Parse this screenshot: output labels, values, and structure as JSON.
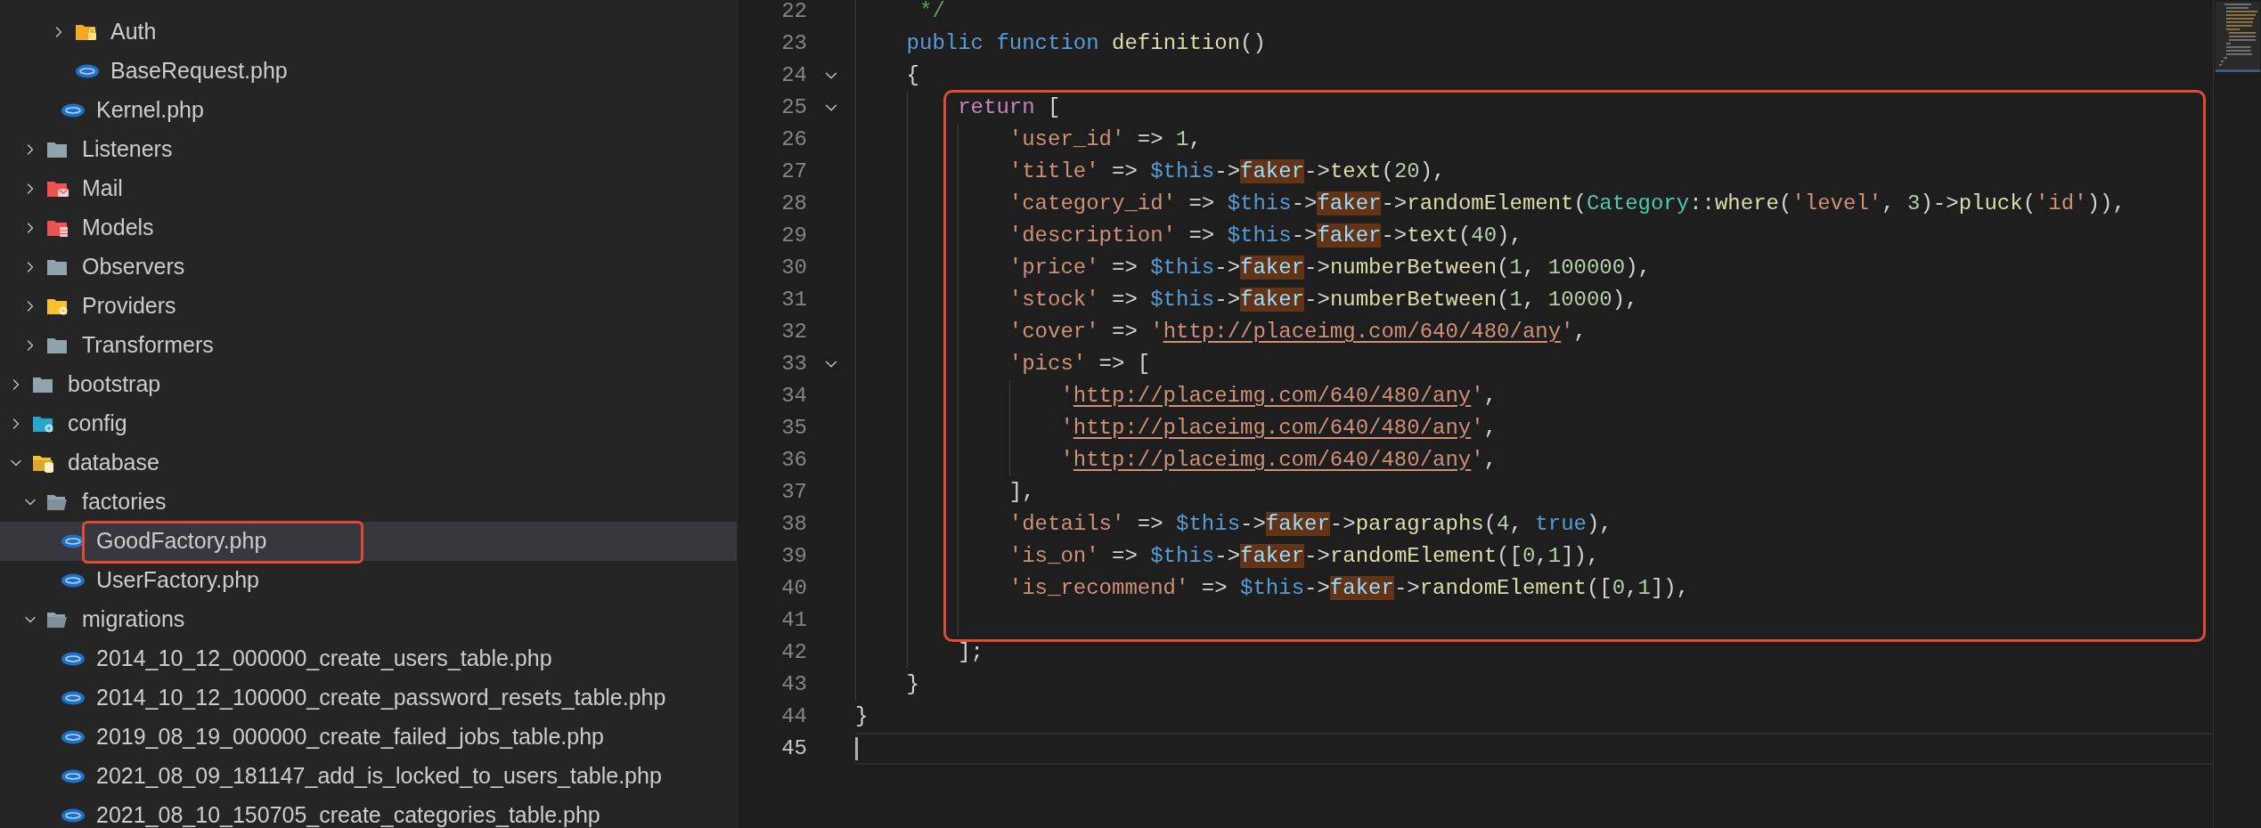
{
  "explorer": {
    "items": [
      {
        "children": [
          {
            "children": [
              {
                "children": [
                  {
                    "label": "Auth",
                    "kind": "lock-folder",
                    "expanded": false,
                    "selected": false,
                    "framed": false
                  },
                  {
                    "label": "BaseRequest.php",
                    "kind": "php-file",
                    "selected": false,
                    "framed": false
                  }
                ]
              },
              {
                "label": "Kernel.php",
                "kind": "php-file",
                "selected": false,
                "framed": false
              }
            ]
          },
          {
            "label": "Listeners",
            "kind": "folder",
            "expanded": false,
            "selected": false,
            "framed": false
          },
          {
            "label": "Mail",
            "kind": "mail-folder",
            "expanded": false,
            "selected": false,
            "framed": false
          },
          {
            "label": "Models",
            "kind": "models-folder",
            "expanded": false,
            "selected": false,
            "framed": false
          },
          {
            "label": "Observers",
            "kind": "folder",
            "expanded": false,
            "selected": false,
            "framed": false
          },
          {
            "label": "Providers",
            "kind": "gear-folder",
            "expanded": false,
            "selected": false,
            "framed": false
          },
          {
            "label": "Transformers",
            "kind": "folder",
            "expanded": false,
            "selected": false,
            "framed": false
          }
        ]
      },
      {
        "label": "bootstrap",
        "kind": "folder",
        "expanded": false,
        "selected": false,
        "framed": false
      },
      {
        "label": "config",
        "kind": "config-folder",
        "expanded": false,
        "selected": false,
        "framed": false
      },
      {
        "label": "database",
        "kind": "database-folder",
        "expanded": true,
        "selected": false,
        "framed": false,
        "children": [
          {
            "label": "factories",
            "kind": "folder",
            "expanded": true,
            "selected": false,
            "framed": false,
            "children": [
              {
                "label": "GoodFactory.php",
                "kind": "php-file",
                "selected": true,
                "framed": true
              },
              {
                "label": "UserFactory.php",
                "kind": "php-file",
                "selected": false,
                "framed": false
              }
            ]
          },
          {
            "label": "migrations",
            "kind": "folder",
            "expanded": true,
            "selected": false,
            "framed": false,
            "children": [
              {
                "label": "2014_10_12_000000_create_users_table.php",
                "kind": "php-file",
                "selected": false,
                "framed": false
              },
              {
                "label": "2014_10_12_100000_create_password_resets_table.php",
                "kind": "php-file",
                "selected": false,
                "framed": false
              },
              {
                "label": "2019_08_19_000000_create_failed_jobs_table.php",
                "kind": "php-file",
                "selected": false,
                "framed": false
              },
              {
                "label": "2021_08_09_181147_add_is_locked_to_users_table.php",
                "kind": "php-file",
                "selected": false,
                "framed": false
              },
              {
                "label": "2021_08_10_150705_create_categories_table.php",
                "kind": "php-file",
                "selected": false,
                "framed": false
              }
            ]
          }
        ]
      }
    ]
  },
  "editor": {
    "lines": [
      {
        "children": [
          {
            "number": "22",
            "fold": false,
            "current": false,
            "framed": false,
            "tokens": [
              {
                "kind": "comment",
                "text": " */"
              }
            ]
          },
          {
            "number": "23",
            "fold": false,
            "current": false,
            "framed": false,
            "tokens": [
              {
                "kind": "keyword",
                "text": "public function "
              },
              {
                "kind": "function",
                "text": "definition"
              },
              {
                "kind": "plain",
                "text": "()"
              }
            ]
          },
          {
            "number": "24",
            "fold": true,
            "current": false,
            "framed": false,
            "tokens": [
              {
                "kind": "plain",
                "text": "{"
              }
            ],
            "children": [
              {
                "number": "25",
                "fold": true,
                "current": false,
                "framed": true,
                "tokens": [
                  {
                    "kind": "control",
                    "text": "return"
                  },
                  {
                    "kind": "plain",
                    "text": " ["
                  }
                ],
                "children": [
                  {
                    "number": "26",
                    "fold": false,
                    "current": false,
                    "framed": false,
                    "tokens": [
                      {
                        "kind": "string",
                        "text": "'user_id'"
                      },
                      {
                        "kind": "plain",
                        "text": " => "
                      },
                      {
                        "kind": "number",
                        "text": "1"
                      },
                      {
                        "kind": "plain",
                        "text": ","
                      }
                    ]
                  },
                  {
                    "number": "27",
                    "fold": false,
                    "current": false,
                    "framed": false,
                    "tokens": [
                      {
                        "kind": "string",
                        "text": "'title'"
                      },
                      {
                        "kind": "plain",
                        "text": " => "
                      },
                      {
                        "kind": "variable",
                        "text": "$this"
                      },
                      {
                        "kind": "plain",
                        "text": "->"
                      },
                      {
                        "kind": "match",
                        "text": "faker"
                      },
                      {
                        "kind": "plain",
                        "text": "->"
                      },
                      {
                        "kind": "function",
                        "text": "text"
                      },
                      {
                        "kind": "plain",
                        "text": "("
                      },
                      {
                        "kind": "number",
                        "text": "20"
                      },
                      {
                        "kind": "plain",
                        "text": "),"
                      }
                    ]
                  },
                  {
                    "number": "28",
                    "fold": false,
                    "current": false,
                    "framed": false,
                    "tokens": [
                      {
                        "kind": "string",
                        "text": "'category_id'"
                      },
                      {
                        "kind": "plain",
                        "text": " => "
                      },
                      {
                        "kind": "variable",
                        "text": "$this"
                      },
                      {
                        "kind": "plain",
                        "text": "->"
                      },
                      {
                        "kind": "match",
                        "text": "faker"
                      },
                      {
                        "kind": "plain",
                        "text": "->"
                      },
                      {
                        "kind": "function",
                        "text": "randomElement"
                      },
                      {
                        "kind": "plain",
                        "text": "("
                      },
                      {
                        "kind": "class",
                        "text": "Category"
                      },
                      {
                        "kind": "plain",
                        "text": "::"
                      },
                      {
                        "kind": "function",
                        "text": "where"
                      },
                      {
                        "kind": "plain",
                        "text": "("
                      },
                      {
                        "kind": "string",
                        "text": "'level'"
                      },
                      {
                        "kind": "plain",
                        "text": ", "
                      },
                      {
                        "kind": "number",
                        "text": "3"
                      },
                      {
                        "kind": "plain",
                        "text": ")->"
                      },
                      {
                        "kind": "function",
                        "text": "pluck"
                      },
                      {
                        "kind": "plain",
                        "text": "("
                      },
                      {
                        "kind": "string",
                        "text": "'id'"
                      },
                      {
                        "kind": "plain",
                        "text": ")),"
                      }
                    ]
                  },
                  {
                    "number": "29",
                    "fold": false,
                    "current": false,
                    "framed": false,
                    "tokens": [
                      {
                        "kind": "string",
                        "text": "'description'"
                      },
                      {
                        "kind": "plain",
                        "text": " => "
                      },
                      {
                        "kind": "variable",
                        "text": "$this"
                      },
                      {
                        "kind": "plain",
                        "text": "->"
                      },
                      {
                        "kind": "match",
                        "text": "faker"
                      },
                      {
                        "kind": "plain",
                        "text": "->"
                      },
                      {
                        "kind": "function",
                        "text": "text"
                      },
                      {
                        "kind": "plain",
                        "text": "("
                      },
                      {
                        "kind": "number",
                        "text": "40"
                      },
                      {
                        "kind": "plain",
                        "text": "),"
                      }
                    ]
                  },
                  {
                    "number": "30",
                    "fold": false,
                    "current": false,
                    "framed": false,
                    "tokens": [
                      {
                        "kind": "string",
                        "text": "'price'"
                      },
                      {
                        "kind": "plain",
                        "text": " => "
                      },
                      {
                        "kind": "variable",
                        "text": "$this"
                      },
                      {
                        "kind": "plain",
                        "text": "->"
                      },
                      {
                        "kind": "match",
                        "text": "faker"
                      },
                      {
                        "kind": "plain",
                        "text": "->"
                      },
                      {
                        "kind": "function",
                        "text": "numberBetween"
                      },
                      {
                        "kind": "plain",
                        "text": "("
                      },
                      {
                        "kind": "number",
                        "text": "1"
                      },
                      {
                        "kind": "plain",
                        "text": ", "
                      },
                      {
                        "kind": "number",
                        "text": "100000"
                      },
                      {
                        "kind": "plain",
                        "text": "),"
                      }
                    ]
                  },
                  {
                    "number": "31",
                    "fold": false,
                    "current": false,
                    "framed": false,
                    "tokens": [
                      {
                        "kind": "string",
                        "text": "'stock'"
                      },
                      {
                        "kind": "plain",
                        "text": " => "
                      },
                      {
                        "kind": "variable",
                        "text": "$this"
                      },
                      {
                        "kind": "plain",
                        "text": "->"
                      },
                      {
                        "kind": "match",
                        "text": "faker"
                      },
                      {
                        "kind": "plain",
                        "text": "->"
                      },
                      {
                        "kind": "function",
                        "text": "numberBetween"
                      },
                      {
                        "kind": "plain",
                        "text": "("
                      },
                      {
                        "kind": "number",
                        "text": "1"
                      },
                      {
                        "kind": "plain",
                        "text": ", "
                      },
                      {
                        "kind": "number",
                        "text": "10000"
                      },
                      {
                        "kind": "plain",
                        "text": "),"
                      }
                    ]
                  },
                  {
                    "number": "32",
                    "fold": false,
                    "current": false,
                    "framed": false,
                    "tokens": [
                      {
                        "kind": "string",
                        "text": "'cover'"
                      },
                      {
                        "kind": "plain",
                        "text": " => "
                      },
                      {
                        "kind": "string",
                        "text": "'"
                      },
                      {
                        "kind": "link",
                        "text": "http://placeimg.com/640/480/any"
                      },
                      {
                        "kind": "string",
                        "text": "'"
                      },
                      {
                        "kind": "plain",
                        "text": ","
                      }
                    ]
                  },
                  {
                    "number": "33",
                    "fold": true,
                    "current": false,
                    "framed": false,
                    "tokens": [
                      {
                        "kind": "string",
                        "text": "'pics'"
                      },
                      {
                        "kind": "plain",
                        "text": " => ["
                      }
                    ],
                    "children": [
                      {
                        "number": "34",
                        "fold": false,
                        "current": false,
                        "framed": false,
                        "tokens": [
                          {
                            "kind": "string",
                            "text": "'"
                          },
                          {
                            "kind": "link",
                            "text": "http://placeimg.com/640/480/any"
                          },
                          {
                            "kind": "string",
                            "text": "'"
                          },
                          {
                            "kind": "plain",
                            "text": ","
                          }
                        ]
                      },
                      {
                        "number": "35",
                        "fold": false,
                        "current": false,
                        "framed": false,
                        "tokens": [
                          {
                            "kind": "string",
                            "text": "'"
                          },
                          {
                            "kind": "link",
                            "text": "http://placeimg.com/640/480/any"
                          },
                          {
                            "kind": "string",
                            "text": "'"
                          },
                          {
                            "kind": "plain",
                            "text": ","
                          }
                        ]
                      },
                      {
                        "number": "36",
                        "fold": false,
                        "current": false,
                        "framed": false,
                        "tokens": [
                          {
                            "kind": "string",
                            "text": "'"
                          },
                          {
                            "kind": "link",
                            "text": "http://placeimg.com/640/480/any"
                          },
                          {
                            "kind": "string",
                            "text": "'"
                          },
                          {
                            "kind": "plain",
                            "text": ","
                          }
                        ]
                      }
                    ]
                  },
                  {
                    "number": "37",
                    "fold": false,
                    "current": false,
                    "framed": false,
                    "tokens": [
                      {
                        "kind": "plain",
                        "text": "],"
                      }
                    ]
                  },
                  {
                    "number": "38",
                    "fold": false,
                    "current": false,
                    "framed": false,
                    "tokens": [
                      {
                        "kind": "string",
                        "text": "'details'"
                      },
                      {
                        "kind": "plain",
                        "text": " => "
                      },
                      {
                        "kind": "variable",
                        "text": "$this"
                      },
                      {
                        "kind": "plain",
                        "text": "->"
                      },
                      {
                        "kind": "match",
                        "text": "faker"
                      },
                      {
                        "kind": "plain",
                        "text": "->"
                      },
                      {
                        "kind": "function",
                        "text": "paragraphs"
                      },
                      {
                        "kind": "plain",
                        "text": "("
                      },
                      {
                        "kind": "number",
                        "text": "4"
                      },
                      {
                        "kind": "plain",
                        "text": ", "
                      },
                      {
                        "kind": "keyword",
                        "text": "true"
                      },
                      {
                        "kind": "plain",
                        "text": "),"
                      }
                    ]
                  },
                  {
                    "number": "39",
                    "fold": false,
                    "current": false,
                    "framed": false,
                    "tokens": [
                      {
                        "kind": "string",
                        "text": "'is_on'"
                      },
                      {
                        "kind": "plain",
                        "text": " => "
                      },
                      {
                        "kind": "variable",
                        "text": "$this"
                      },
                      {
                        "kind": "plain",
                        "text": "->"
                      },
                      {
                        "kind": "match",
                        "text": "faker"
                      },
                      {
                        "kind": "plain",
                        "text": "->"
                      },
                      {
                        "kind": "function",
                        "text": "randomElement"
                      },
                      {
                        "kind": "plain",
                        "text": "(["
                      },
                      {
                        "kind": "number",
                        "text": "0"
                      },
                      {
                        "kind": "plain",
                        "text": ","
                      },
                      {
                        "kind": "number",
                        "text": "1"
                      },
                      {
                        "kind": "plain",
                        "text": "]),"
                      }
                    ]
                  },
                  {
                    "number": "40",
                    "fold": false,
                    "current": false,
                    "framed": false,
                    "tokens": [
                      {
                        "kind": "string",
                        "text": "'is_recommend'"
                      },
                      {
                        "kind": "plain",
                        "text": " => "
                      },
                      {
                        "kind": "variable",
                        "text": "$this"
                      },
                      {
                        "kind": "plain",
                        "text": "->"
                      },
                      {
                        "kind": "match",
                        "text": "faker"
                      },
                      {
                        "kind": "plain",
                        "text": "->"
                      },
                      {
                        "kind": "function",
                        "text": "randomElement"
                      },
                      {
                        "kind": "plain",
                        "text": "(["
                      },
                      {
                        "kind": "number",
                        "text": "0"
                      },
                      {
                        "kind": "plain",
                        "text": ","
                      },
                      {
                        "kind": "number",
                        "text": "1"
                      },
                      {
                        "kind": "plain",
                        "text": "]),"
                      }
                    ]
                  },
                  {
                    "number": "41",
                    "fold": false,
                    "current": false,
                    "framed": false
                  }
                ]
              },
              {
                "number": "42",
                "fold": false,
                "current": false,
                "framed": false,
                "tokens": [
                  {
                    "kind": "plain",
                    "text": "];"
                  }
                ]
              }
            ]
          },
          {
            "number": "43",
            "fold": false,
            "current": false,
            "framed": false,
            "tokens": [
              {
                "kind": "plain",
                "text": "}"
              }
            ]
          }
        ]
      },
      {
        "number": "44",
        "fold": false,
        "current": false,
        "framed": false,
        "tokens": [
          {
            "kind": "plain",
            "text": "}"
          }
        ]
      },
      {
        "number": "45",
        "fold": false,
        "current": true,
        "framed": false
      }
    ]
  }
}
